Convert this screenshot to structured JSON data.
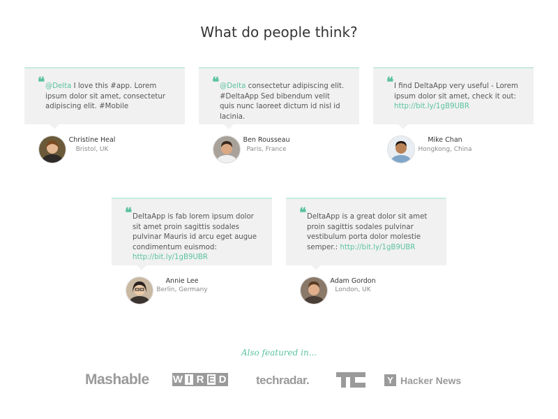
{
  "header": {
    "title": "What do people think?"
  },
  "testimonials": [
    {
      "mention": "@Delta",
      "text": " I love this #app. Lorem ipsum dolor sit amet, consectetur adipiscing elit. #Mobile",
      "link": "",
      "name": "Christine Heal",
      "location": "Bristol, UK"
    },
    {
      "mention": "@Delta",
      "text": " consectetur adipiscing elit. #DeltaApp Sed bibendum velit quis nunc laoreet dictum id nisl id lacinia.",
      "link": "",
      "name": "Ben Rousseau",
      "location": "Paris, France"
    },
    {
      "mention": "",
      "text": " I find DeltaApp very useful - Lorem ipsum dolor sit amet, check it out: ",
      "link": "http://bit.ly/1gB9UBR",
      "name": "Mike Chan",
      "location": "Hongkong, China"
    },
    {
      "mention": "",
      "text": " DeltaApp is fab lorem ipsum dolor sit amet proin sagittis sodales pulvinar Mauris id arcu eget augue condimentum euismod: ",
      "link": "http://bit.ly/1gB9UBR",
      "name": "Annie Lee",
      "location": "Berlin, Germany"
    },
    {
      "mention": "",
      "text": " DeltaApp is a great dolor sit amet proin sagittis sodales pulvinar vestibulum porta dolor molestie semper.: ",
      "link": "http://bit.ly/1gB9UBR",
      "name": "Adam Gordon",
      "location": "London, UK"
    }
  ],
  "featured": {
    "label": "Also featured in...",
    "logos": {
      "mashable": "Mashable",
      "wired": [
        "W",
        "I",
        "R",
        "E",
        "D"
      ],
      "techradar": "techradar.",
      "techcrunch": "TC",
      "hacker_news_mark": "Y",
      "hacker_news": "Hacker News"
    }
  },
  "colors": {
    "accent": "#5cc39e",
    "card_bg": "#f1f1f1",
    "card_border": "#c7ecdc",
    "logo_gray": "#9a9a9a"
  },
  "icons": {
    "quote": "quote-icon"
  }
}
